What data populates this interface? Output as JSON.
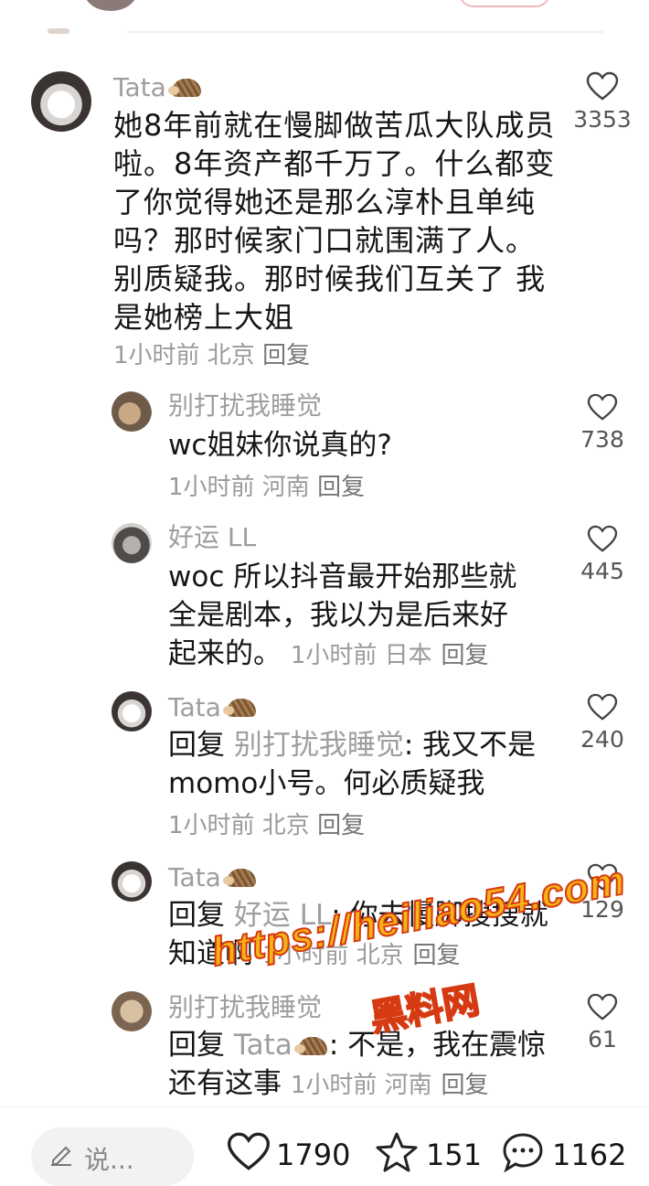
{
  "comments": [
    {
      "name": "Tata",
      "text": "她8年前就在慢脚做苦瓜大队成员啦。8年资产都千万了。什么都变了你觉得她还是那么淳朴且单纯吗？那时候家门口就围满了人。别质疑我。那时候我们互关了 我是她榜上大姐",
      "meta": "1小时前 北京",
      "reply": "回复",
      "likes": "3353"
    }
  ],
  "replies": [
    {
      "name": "别打扰我睡觉",
      "text": "wc姐妹你说真的?",
      "meta": "1小时前 河南",
      "reply": "回复",
      "likes": "738"
    },
    {
      "name": "好运 LL",
      "text": "woc 所以抖音最开始那些就全是剧本，我以为是后来好起来的。",
      "meta": "1小时前 日本",
      "reply": "回复",
      "likes": "445"
    },
    {
      "name": "Tata",
      "reply_prefix": "回复",
      "reply_to": "别打扰我睡觉",
      "text": ": 我又不是momo小号。何必质疑我",
      "meta": "1小时前 北京",
      "reply": "回复",
      "likes": "240"
    },
    {
      "name": "Tata",
      "reply_prefix": "回复",
      "reply_to": "好运 LL",
      "text": ": 你去慢脚搜搜就知道啊",
      "meta": "1小时前 北京",
      "reply": "回复",
      "likes": "129"
    },
    {
      "name": "别打扰我睡觉",
      "reply_prefix": "回复",
      "reply_to": "Tata",
      "text": ": 不是，我在震惊还有这事",
      "meta": "1小时前 河南",
      "reply": "回复",
      "likes": "61"
    }
  ],
  "watermark": {
    "url": "https://heiliao54.com",
    "name": "黑料网"
  },
  "bottom_bar": {
    "input_placeholder": "说...",
    "likes": "1790",
    "favorites": "151",
    "comments": "1162"
  }
}
